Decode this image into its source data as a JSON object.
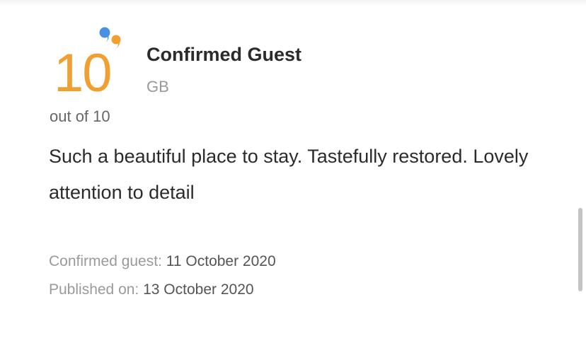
{
  "score": {
    "value": "10",
    "caption": "out of 10",
    "accent_color": "#f0a030",
    "icon": "speech-bubbles-icon",
    "icon_colors": [
      "#4a90e2",
      "#f0a030"
    ]
  },
  "reviewer": {
    "name": "Confirmed Guest",
    "country": "GB"
  },
  "review": {
    "text": "Such a beautiful place to stay. Tastefully restored. Lovely attention to detail"
  },
  "meta": {
    "stay_label": "Confirmed guest:",
    "stay_date": "11 October 2020",
    "published_label": "Published on:",
    "published_date": "13 October 2020"
  }
}
